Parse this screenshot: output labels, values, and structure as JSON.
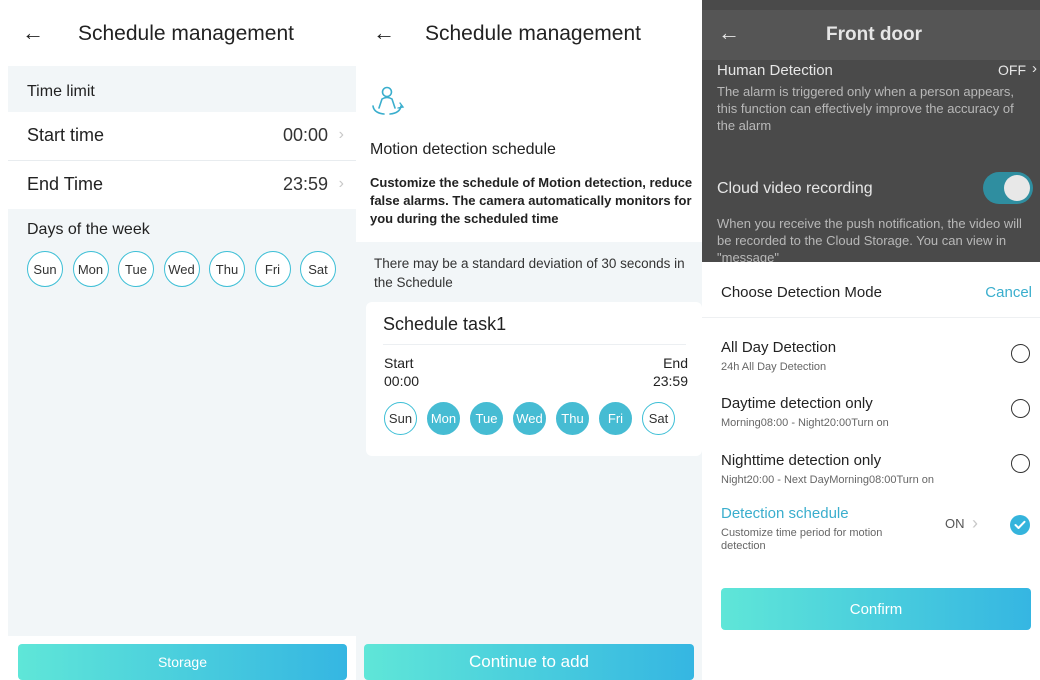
{
  "panel1": {
    "title": "Schedule management",
    "section_time": "Time limit",
    "start_label": "Start time",
    "start_value": "00:00",
    "end_label": "End Time",
    "end_value": "23:59",
    "section_days": "Days of the week",
    "days": [
      "Sun",
      "Mon",
      "Tue",
      "Wed",
      "Thu",
      "Fri",
      "Sat"
    ],
    "button": "Storage"
  },
  "panel2": {
    "title": "Schedule management",
    "motion_title": "Motion detection schedule",
    "motion_desc": "Customize the schedule of Motion detection, reduce false alarms. The camera automatically monitors for you during the scheduled time",
    "note": "There may be a standard deviation of 30 seconds in the Schedule",
    "task": {
      "title": "Schedule task1",
      "start_label": "Start",
      "start_value": "00:00",
      "end_label": "End",
      "end_value": "23:59",
      "days": [
        "Sun",
        "Mon",
        "Tue",
        "Wed",
        "Thu",
        "Fri",
        "Sat"
      ],
      "selected_days": [
        "Mon",
        "Tue",
        "Wed",
        "Thu",
        "Fri"
      ]
    },
    "button": "Continue to add"
  },
  "panel3": {
    "title": "Front door",
    "human_label": "Human Detection",
    "human_value": "OFF",
    "human_desc": "The alarm is triggered only when a person appears, this function can effectively improve the accuracy of the alarm",
    "cloud_label": "Cloud video recording",
    "cloud_desc": "When you receive the push notification, the video will be recorded to the Cloud Storage. You can view in \"message\"",
    "sheet": {
      "title": "Choose Detection Mode",
      "cancel": "Cancel",
      "options": [
        {
          "title": "All Day Detection",
          "sub": "24h All Day Detection"
        },
        {
          "title": "Daytime detection only",
          "sub": "Morning08:00 - Night20:00Turn on"
        },
        {
          "title": "Nighttime detection only",
          "sub": "Night20:00 - Next DayMorning08:00Turn on"
        },
        {
          "title": "Detection schedule",
          "sub": "Customize time period for motion detection",
          "value": "ON"
        }
      ],
      "confirm": "Confirm"
    }
  },
  "colors": {
    "accent": "#35b4dc",
    "day_selected": "#46bcd3",
    "gradient_start": "#5fe6d8",
    "gradient_end": "#35b6e2"
  }
}
